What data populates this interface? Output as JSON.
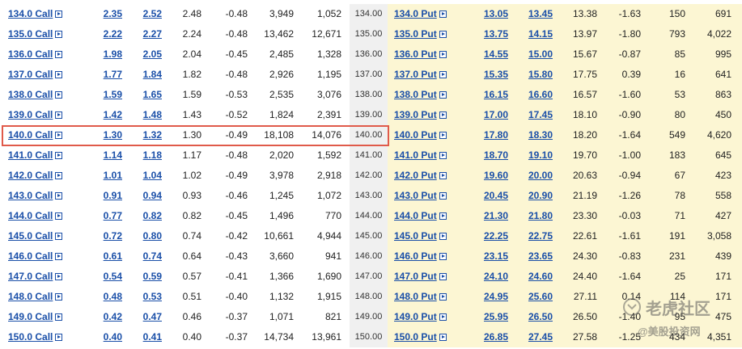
{
  "icons": {
    "popup": "popup-arrow-icon",
    "logo": "tiger-logo-icon"
  },
  "colors": {
    "link": "#1a4fa8",
    "put_background": "#fcf6d3",
    "strike_background": "#f0f0f0",
    "highlight_border": "#e05a4a"
  },
  "highlighted_strike": "140.00",
  "rows": [
    {
      "call": {
        "symbol": "134.0 Call",
        "bid": "2.35",
        "ask": "2.52",
        "last": "2.48",
        "change": "-0.48",
        "volume": "3,949",
        "open_int": "1,052"
      },
      "strike": "134.00",
      "put": {
        "symbol": "134.0 Put",
        "bid": "13.05",
        "ask": "13.45",
        "last": "13.38",
        "change": "-1.63",
        "volume": "150",
        "open_int": "691"
      }
    },
    {
      "call": {
        "symbol": "135.0 Call",
        "bid": "2.22",
        "ask": "2.27",
        "last": "2.24",
        "change": "-0.48",
        "volume": "13,462",
        "open_int": "12,671"
      },
      "strike": "135.00",
      "put": {
        "symbol": "135.0 Put",
        "bid": "13.75",
        "ask": "14.15",
        "last": "13.97",
        "change": "-1.80",
        "volume": "793",
        "open_int": "4,022"
      }
    },
    {
      "call": {
        "symbol": "136.0 Call",
        "bid": "1.98",
        "ask": "2.05",
        "last": "2.04",
        "change": "-0.45",
        "volume": "2,485",
        "open_int": "1,328"
      },
      "strike": "136.00",
      "put": {
        "symbol": "136.0 Put",
        "bid": "14.55",
        "ask": "15.00",
        "last": "15.67",
        "change": "-0.87",
        "volume": "85",
        "open_int": "995"
      }
    },
    {
      "call": {
        "symbol": "137.0 Call",
        "bid": "1.77",
        "ask": "1.84",
        "last": "1.82",
        "change": "-0.48",
        "volume": "2,926",
        "open_int": "1,195"
      },
      "strike": "137.00",
      "put": {
        "symbol": "137.0 Put",
        "bid": "15.35",
        "ask": "15.80",
        "last": "17.75",
        "change": "0.39",
        "volume": "16",
        "open_int": "641"
      }
    },
    {
      "call": {
        "symbol": "138.0 Call",
        "bid": "1.59",
        "ask": "1.65",
        "last": "1.59",
        "change": "-0.53",
        "volume": "2,535",
        "open_int": "3,076"
      },
      "strike": "138.00",
      "put": {
        "symbol": "138.0 Put",
        "bid": "16.15",
        "ask": "16.60",
        "last": "16.57",
        "change": "-1.60",
        "volume": "53",
        "open_int": "863"
      }
    },
    {
      "call": {
        "symbol": "139.0 Call",
        "bid": "1.42",
        "ask": "1.48",
        "last": "1.43",
        "change": "-0.52",
        "volume": "1,824",
        "open_int": "2,391"
      },
      "strike": "139.00",
      "put": {
        "symbol": "139.0 Put",
        "bid": "17.00",
        "ask": "17.45",
        "last": "18.10",
        "change": "-0.90",
        "volume": "80",
        "open_int": "450"
      }
    },
    {
      "call": {
        "symbol": "140.0 Call",
        "bid": "1.30",
        "ask": "1.32",
        "last": "1.30",
        "change": "-0.49",
        "volume": "18,108",
        "open_int": "14,076"
      },
      "strike": "140.00",
      "put": {
        "symbol": "140.0 Put",
        "bid": "17.80",
        "ask": "18.30",
        "last": "18.20",
        "change": "-1.64",
        "volume": "549",
        "open_int": "4,620"
      }
    },
    {
      "call": {
        "symbol": "141.0 Call",
        "bid": "1.14",
        "ask": "1.18",
        "last": "1.17",
        "change": "-0.48",
        "volume": "2,020",
        "open_int": "1,592"
      },
      "strike": "141.00",
      "put": {
        "symbol": "141.0 Put",
        "bid": "18.70",
        "ask": "19.10",
        "last": "19.70",
        "change": "-1.00",
        "volume": "183",
        "open_int": "645"
      }
    },
    {
      "call": {
        "symbol": "142.0 Call",
        "bid": "1.01",
        "ask": "1.04",
        "last": "1.02",
        "change": "-0.49",
        "volume": "3,978",
        "open_int": "2,918"
      },
      "strike": "142.00",
      "put": {
        "symbol": "142.0 Put",
        "bid": "19.60",
        "ask": "20.00",
        "last": "20.63",
        "change": "-0.94",
        "volume": "67",
        "open_int": "423"
      }
    },
    {
      "call": {
        "symbol": "143.0 Call",
        "bid": "0.91",
        "ask": "0.94",
        "last": "0.93",
        "change": "-0.46",
        "volume": "1,245",
        "open_int": "1,072"
      },
      "strike": "143.00",
      "put": {
        "symbol": "143.0 Put",
        "bid": "20.45",
        "ask": "20.90",
        "last": "21.19",
        "change": "-1.26",
        "volume": "78",
        "open_int": "558"
      }
    },
    {
      "call": {
        "symbol": "144.0 Call",
        "bid": "0.77",
        "ask": "0.82",
        "last": "0.82",
        "change": "-0.45",
        "volume": "1,496",
        "open_int": "770"
      },
      "strike": "144.00",
      "put": {
        "symbol": "144.0 Put",
        "bid": "21.30",
        "ask": "21.80",
        "last": "23.30",
        "change": "-0.03",
        "volume": "71",
        "open_int": "427"
      }
    },
    {
      "call": {
        "symbol": "145.0 Call",
        "bid": "0.72",
        "ask": "0.80",
        "last": "0.74",
        "change": "-0.42",
        "volume": "10,661",
        "open_int": "4,944"
      },
      "strike": "145.00",
      "put": {
        "symbol": "145.0 Put",
        "bid": "22.25",
        "ask": "22.75",
        "last": "22.61",
        "change": "-1.61",
        "volume": "191",
        "open_int": "3,058"
      }
    },
    {
      "call": {
        "symbol": "146.0 Call",
        "bid": "0.61",
        "ask": "0.74",
        "last": "0.64",
        "change": "-0.43",
        "volume": "3,660",
        "open_int": "941"
      },
      "strike": "146.00",
      "put": {
        "symbol": "146.0 Put",
        "bid": "23.15",
        "ask": "23.65",
        "last": "24.30",
        "change": "-0.83",
        "volume": "231",
        "open_int": "439"
      }
    },
    {
      "call": {
        "symbol": "147.0 Call",
        "bid": "0.54",
        "ask": "0.59",
        "last": "0.57",
        "change": "-0.41",
        "volume": "1,366",
        "open_int": "1,690"
      },
      "strike": "147.00",
      "put": {
        "symbol": "147.0 Put",
        "bid": "24.10",
        "ask": "24.60",
        "last": "24.40",
        "change": "-1.64",
        "volume": "25",
        "open_int": "171"
      }
    },
    {
      "call": {
        "symbol": "148.0 Call",
        "bid": "0.48",
        "ask": "0.53",
        "last": "0.51",
        "change": "-0.40",
        "volume": "1,132",
        "open_int": "1,915"
      },
      "strike": "148.00",
      "put": {
        "symbol": "148.0 Put",
        "bid": "24.95",
        "ask": "25.60",
        "last": "27.11",
        "change": "0.14",
        "volume": "114",
        "open_int": "171"
      }
    },
    {
      "call": {
        "symbol": "149.0 Call",
        "bid": "0.42",
        "ask": "0.47",
        "last": "0.46",
        "change": "-0.37",
        "volume": "1,071",
        "open_int": "821"
      },
      "strike": "149.00",
      "put": {
        "symbol": "149.0 Put",
        "bid": "25.95",
        "ask": "26.50",
        "last": "26.50",
        "change": "-1.40",
        "volume": "95",
        "open_int": "475"
      }
    },
    {
      "call": {
        "symbol": "150.0 Call",
        "bid": "0.40",
        "ask": "0.41",
        "last": "0.40",
        "change": "-0.37",
        "volume": "14,734",
        "open_int": "13,961"
      },
      "strike": "150.00",
      "put": {
        "symbol": "150.0 Put",
        "bid": "26.85",
        "ask": "27.45",
        "last": "27.58",
        "change": "-1.25",
        "volume": "434",
        "open_int": "4,351"
      }
    }
  ],
  "watermark": {
    "main": "老虎社区",
    "sub": "@美股投资网"
  }
}
